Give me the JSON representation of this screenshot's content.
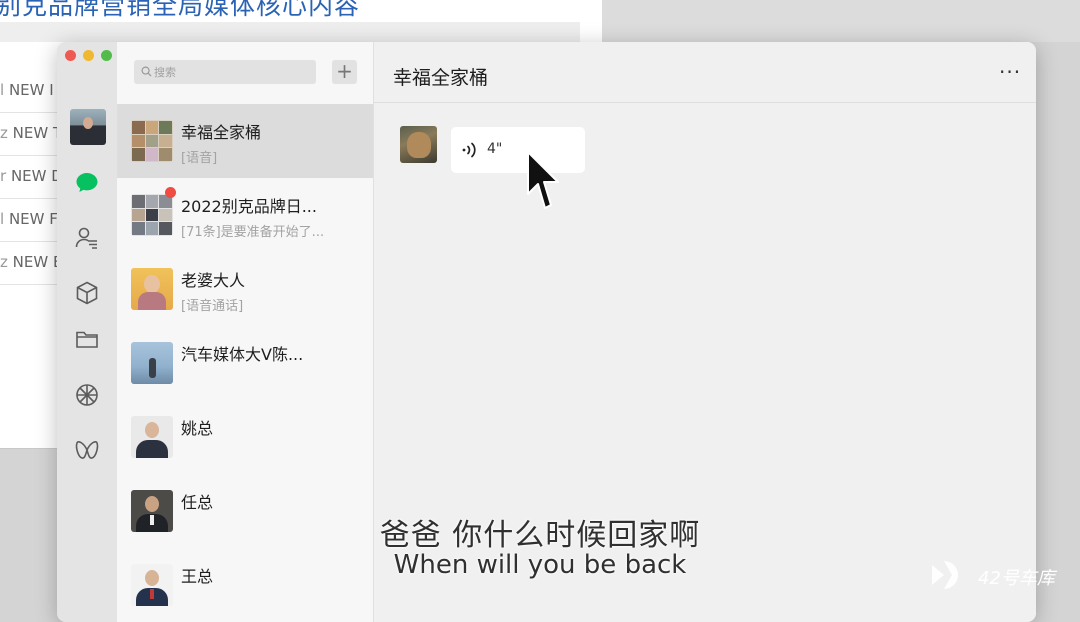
{
  "background_doc": {
    "title": "别克品牌营销全局媒体核心内容",
    "row_labels": [
      "NEW I",
      "NEW T",
      "NEW D",
      "NEW F",
      "NEW E"
    ]
  },
  "sidebar": {
    "search_placeholder": "搜索",
    "add_label": "+"
  },
  "chats": [
    {
      "name": "幸福全家桶",
      "preview": "[语音]",
      "active": true
    },
    {
      "name": "2022别克品牌日...",
      "preview": "[71条]是要准备开始了...",
      "unread": true
    },
    {
      "name": "老婆大人",
      "preview": "[语音通话]"
    },
    {
      "name": "汽车媒体大V陈...",
      "preview": ""
    },
    {
      "name": "姚总",
      "preview": ""
    },
    {
      "name": "任总",
      "preview": ""
    },
    {
      "name": "王总",
      "preview": ""
    }
  ],
  "conversation": {
    "title": "幸福全家桶",
    "more_label": "···",
    "voice_message": {
      "duration": "4\""
    }
  },
  "subtitles": {
    "chinese": "爸爸 你什么时候回家啊",
    "english": "When will you be back"
  },
  "watermark": {
    "text": "42号车库"
  },
  "colors": {
    "accent_green": "#07c160",
    "unread_red": "#f04c42",
    "link_blue": "#2a63b6"
  }
}
